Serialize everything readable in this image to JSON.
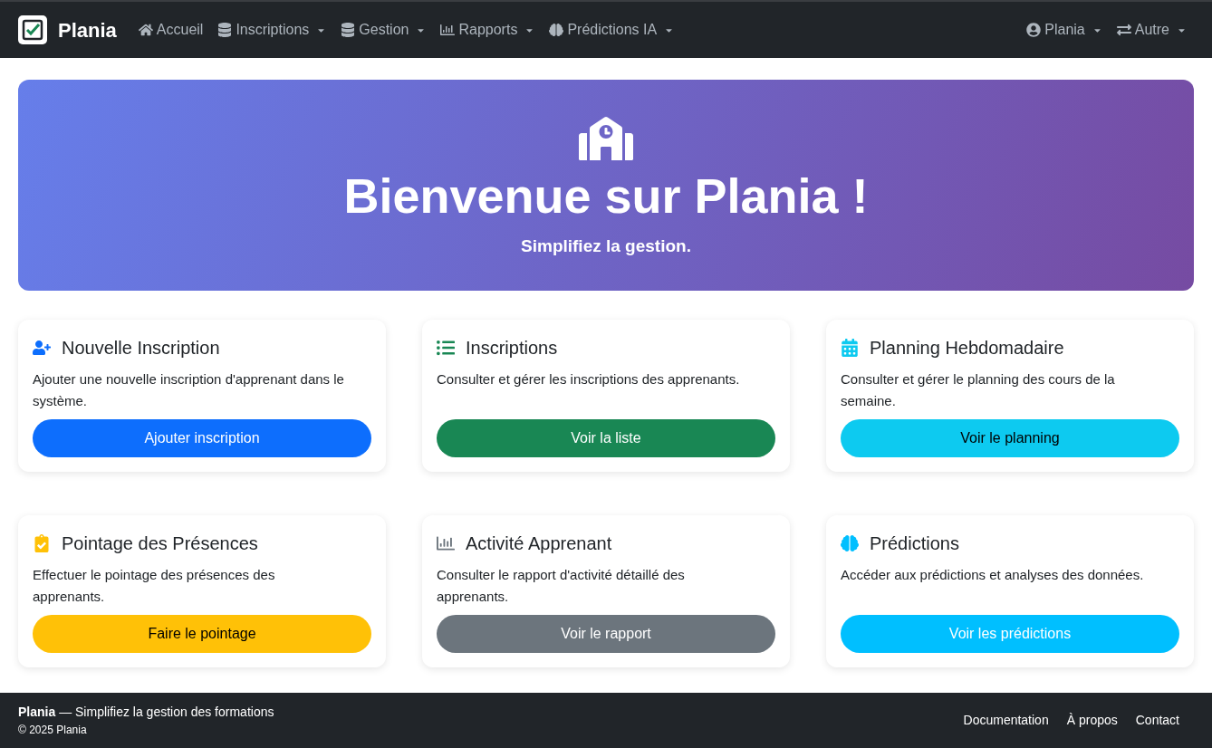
{
  "navbar": {
    "brand": "Plania",
    "items": [
      {
        "label": "Accueil",
        "dropdown": false
      },
      {
        "label": "Inscriptions",
        "dropdown": true
      },
      {
        "label": "Gestion",
        "dropdown": true
      },
      {
        "label": "Rapports",
        "dropdown": true
      },
      {
        "label": "Prédictions IA",
        "dropdown": true
      }
    ],
    "right_items": [
      {
        "label": "Plania",
        "dropdown": true
      },
      {
        "label": "Autre",
        "dropdown": true
      }
    ]
  },
  "hero": {
    "title": "Bienvenue sur Plania !",
    "subtitle": "Simplifiez la gestion."
  },
  "cards": [
    {
      "title": "Nouvelle Inscription",
      "text": "Ajouter une nouvelle inscription d'apprenant dans le système.",
      "button": "Ajouter inscription",
      "kind": "primary"
    },
    {
      "title": "Inscriptions",
      "text": "Consulter et gérer les inscriptions des apprenants.",
      "button": "Voir la liste",
      "kind": "success"
    },
    {
      "title": "Planning Hebdomadaire",
      "text": "Consulter et gérer le planning des cours de la semaine.",
      "button": "Voir le planning",
      "kind": "info"
    },
    {
      "title": "Pointage des Présences",
      "text": "Effectuer le pointage des présences des apprenants.",
      "button": "Faire le pointage",
      "kind": "warning"
    },
    {
      "title": "Activité Apprenant",
      "text": "Consulter le rapport d'activité détaillé des apprenants.",
      "button": "Voir le rapport",
      "kind": "secondary"
    },
    {
      "title": "Prédictions",
      "text": "Accéder aux prédictions et analyses des données.",
      "button": "Voir les prédictions",
      "kind": "sky"
    }
  ],
  "footer": {
    "tagline": "**Plania** — Simplifiez la gestion des formations",
    "copyright": "© 2025 Plania",
    "links": [
      "Documentation",
      "À propos",
      "Contact"
    ]
  }
}
